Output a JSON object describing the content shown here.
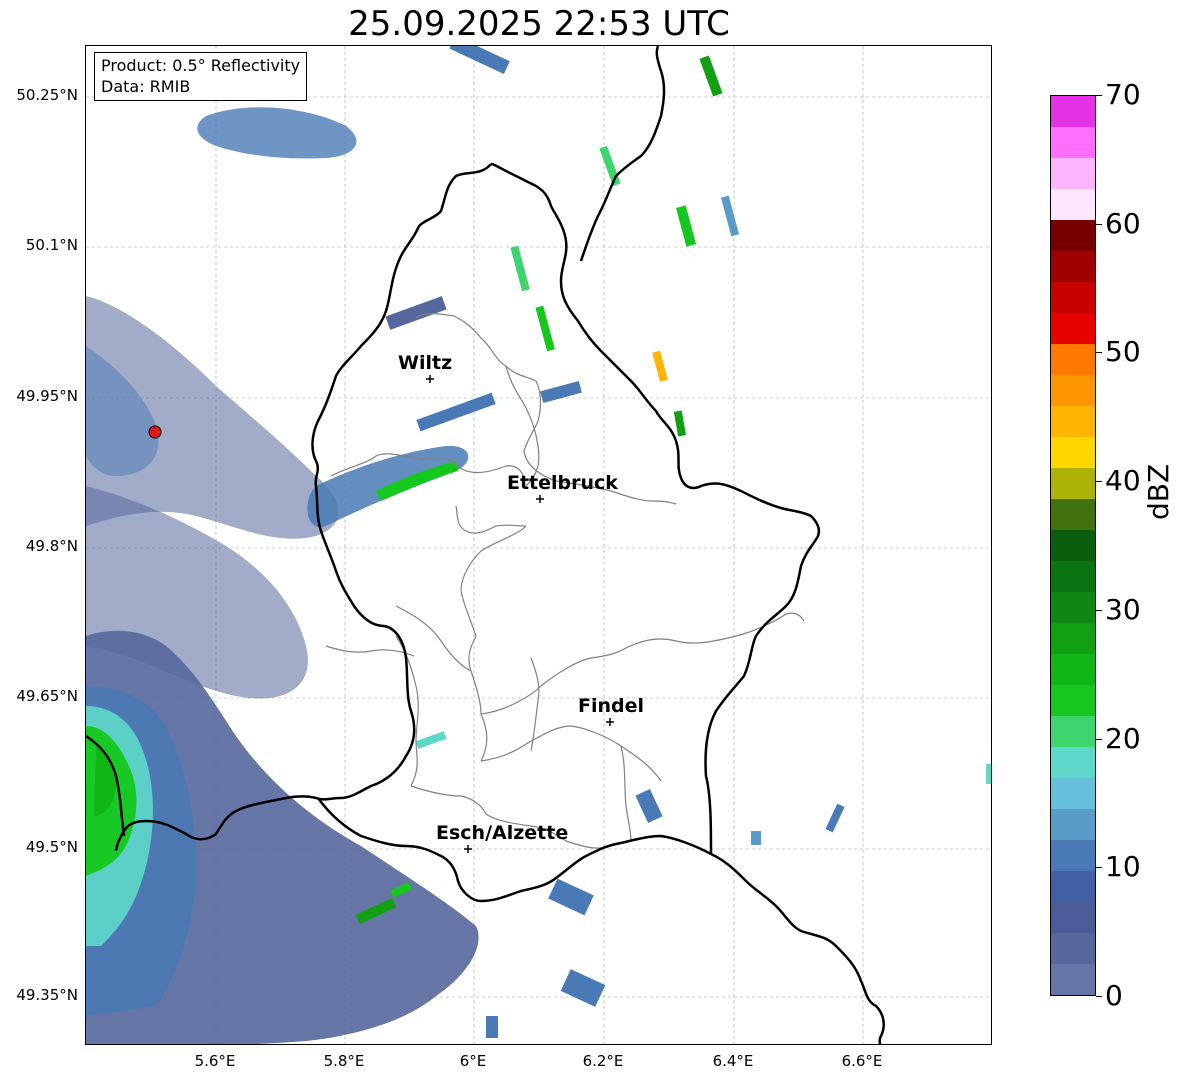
{
  "title": "25.09.2025 22:53 UTC",
  "info": {
    "product": "Product: 0.5° Reflectivity",
    "data_source": "Data: RMIB"
  },
  "axes": {
    "lat_ticks": [
      "50.25°N",
      "50.1°N",
      "49.95°N",
      "49.8°N",
      "49.65°N",
      "49.5°N",
      "49.35°N"
    ],
    "lon_ticks": [
      "5.6°E",
      "5.8°E",
      "6°E",
      "6.2°E",
      "6.4°E",
      "6.6°E"
    ]
  },
  "cities": [
    {
      "name": "Wiltz"
    },
    {
      "name": "Ettelbruck"
    },
    {
      "name": "Findel"
    },
    {
      "name": "Esch/Alzette"
    }
  ],
  "radar_site": {
    "marker_color": "#e31a1c"
  },
  "colorbar": {
    "label": "dBZ",
    "tick_labels": [
      "0",
      "10",
      "20",
      "30",
      "40",
      "50",
      "60",
      "70"
    ],
    "range": [
      0,
      70
    ],
    "step": 2.5,
    "colors": [
      "#6675a8",
      "#56679d",
      "#4a5d9a",
      "#425fa5",
      "#4a7ab5",
      "#5a9cc8",
      "#66c0dc",
      "#5ed8c9",
      "#3ed46e",
      "#14c81e",
      "#10b614",
      "#11a012",
      "#0e8812",
      "#0a7410",
      "#0a5e0c",
      "#42720e",
      "#acb206",
      "#ffd700",
      "#ffb400",
      "#ff9600",
      "#ff7800",
      "#e60000",
      "#c80000",
      "#a00000",
      "#780000",
      "#ffe6ff",
      "#ffb4ff",
      "#ff6eff",
      "#e632e6"
    ]
  }
}
